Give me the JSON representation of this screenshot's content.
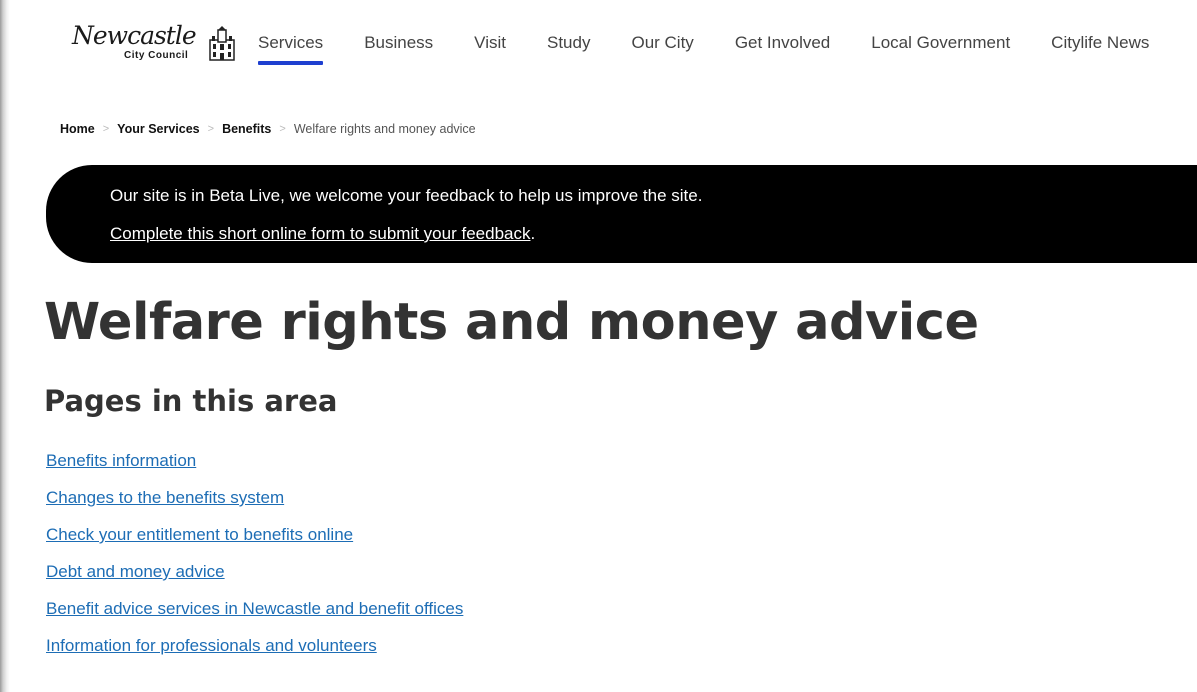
{
  "header": {
    "logo": {
      "word": "Newcastle",
      "subtitle": "City Council",
      "icon": "castle-crest-icon"
    },
    "nav": [
      {
        "label": "Services",
        "active": true
      },
      {
        "label": "Business",
        "active": false
      },
      {
        "label": "Visit",
        "active": false
      },
      {
        "label": "Study",
        "active": false
      },
      {
        "label": "Our City",
        "active": false
      },
      {
        "label": "Get Involved",
        "active": false
      },
      {
        "label": "Local Government",
        "active": false
      },
      {
        "label": "Citylife News",
        "active": false
      }
    ],
    "active_color": "#1e3fd0"
  },
  "breadcrumb": {
    "items": [
      "Home",
      "Your Services",
      "Benefits"
    ],
    "current": "Welfare rights and money advice",
    "separator": ">"
  },
  "banner": {
    "message": "Our site is in Beta Live, we welcome your feedback to help us improve the site.",
    "link_text": "Complete this short online form to submit your feedback",
    "link_suffix": "."
  },
  "main": {
    "title": "Welfare rights and money advice",
    "section_title": "Pages in this area",
    "links": [
      "Benefits information",
      "Changes to the benefits system ",
      "Check your entitlement to benefits online ",
      "Debt and money advice",
      "Benefit advice services in Newcastle and benefit offices ",
      "Information for professionals and volunteers"
    ],
    "link_color": "#1d6db5"
  }
}
